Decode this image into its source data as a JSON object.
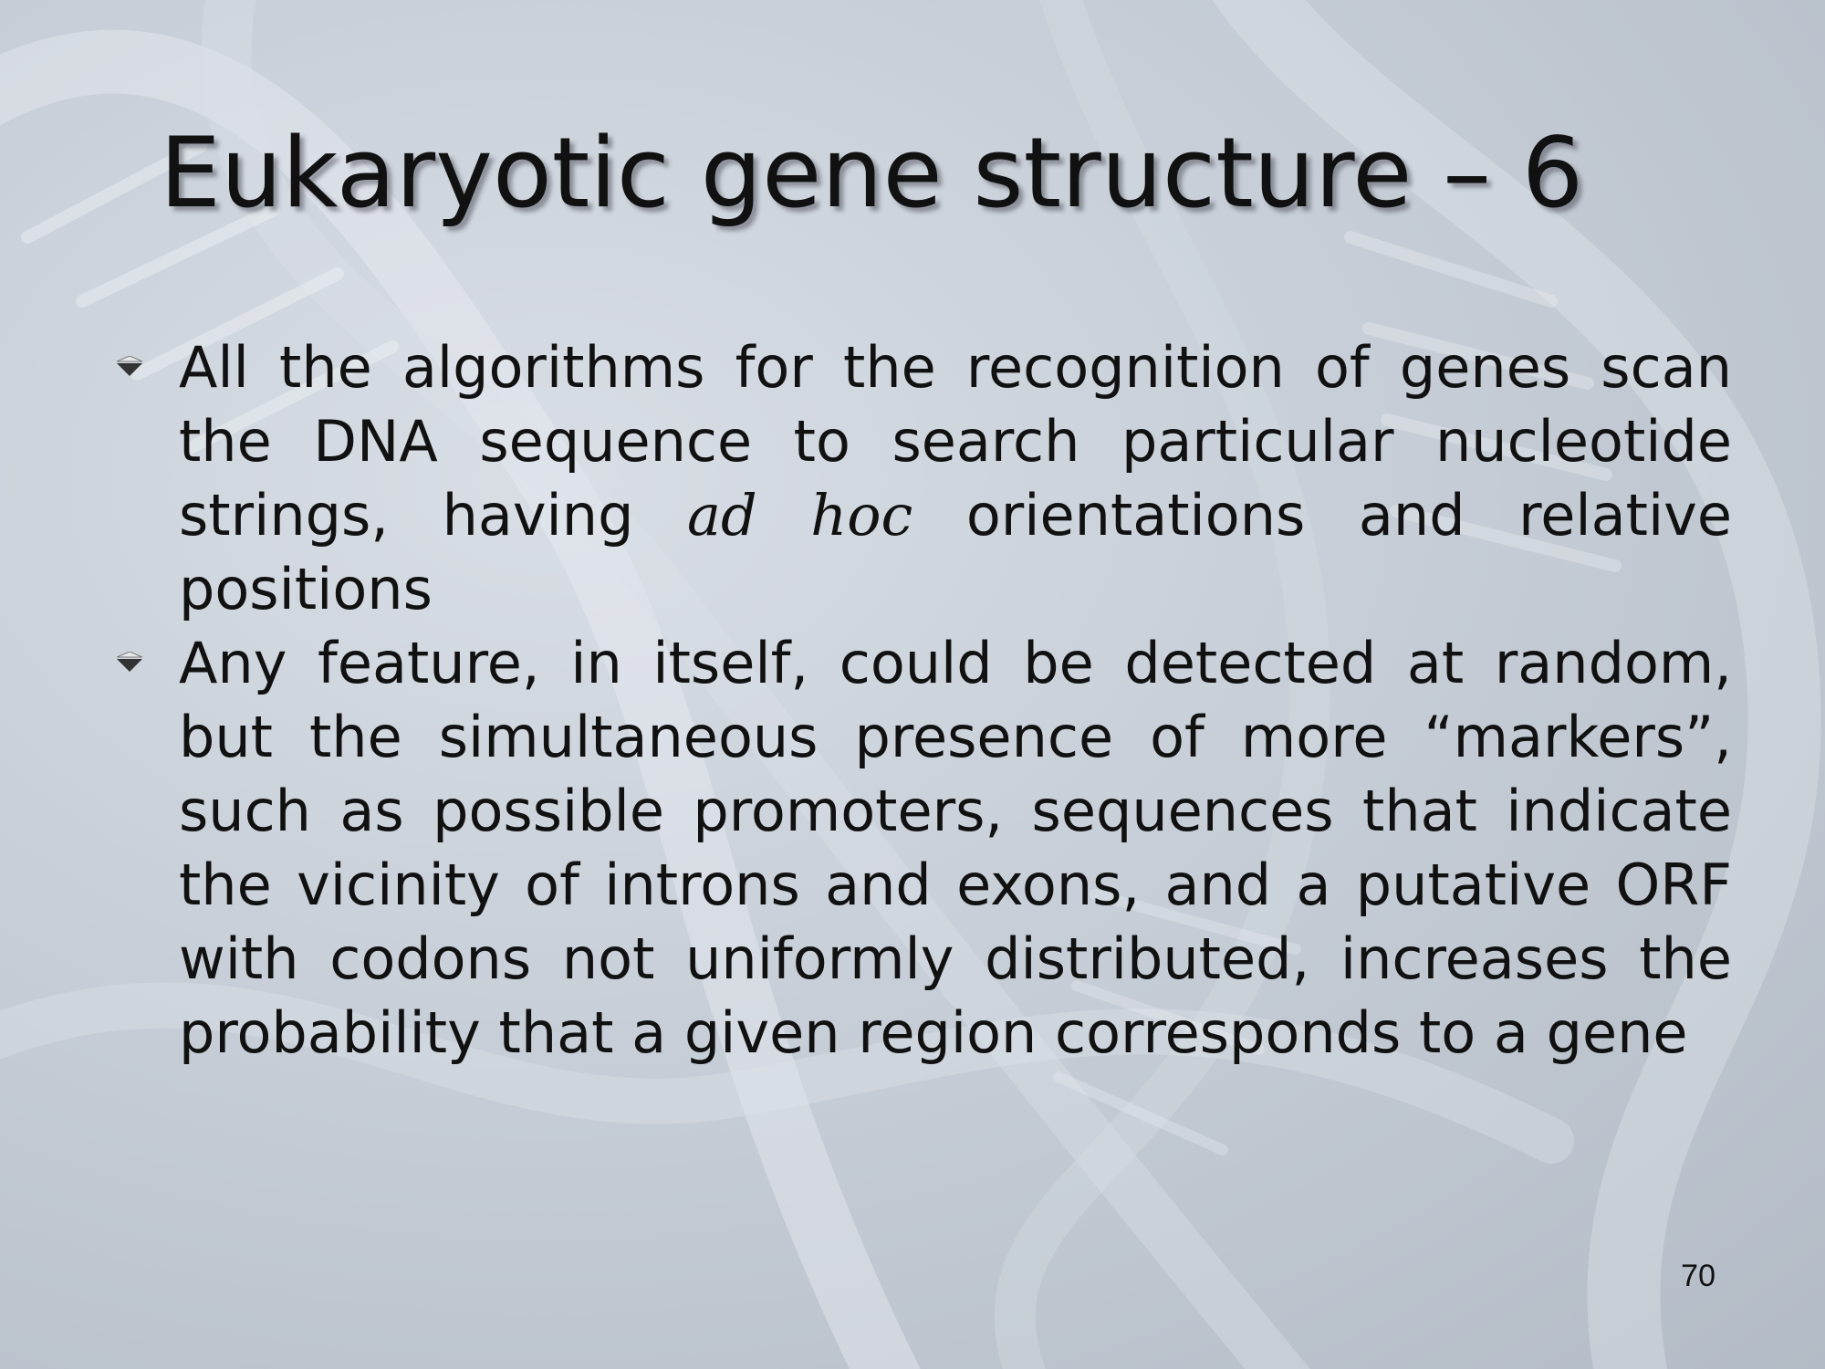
{
  "slide": {
    "title": "Eukaryotic gene structure – 6",
    "bullets": [
      {
        "text_before": "All the algorithms for the recognition of genes scan the DNA sequence to search particular nucle­otide strings, having ",
        "italic": "ad hoc",
        "text_after": " orientations and relat­ive positions"
      },
      {
        "text": "Any feature, in itself, could be detected at ran­dom, but the simultaneous presence of more “markers”, such as possible promoters, sequences that indicate the vicinity of introns and exons, and a putative ORF with codons not uniformly distrib­uted, increases the probability that a given region corresponds to a gene"
      }
    ],
    "page_number": "70"
  },
  "colors": {
    "background": "#c3cad3",
    "text": "#111111"
  },
  "icons": {
    "bullet": "arrow-bullet-icon",
    "background": "dna-helix-icon"
  }
}
